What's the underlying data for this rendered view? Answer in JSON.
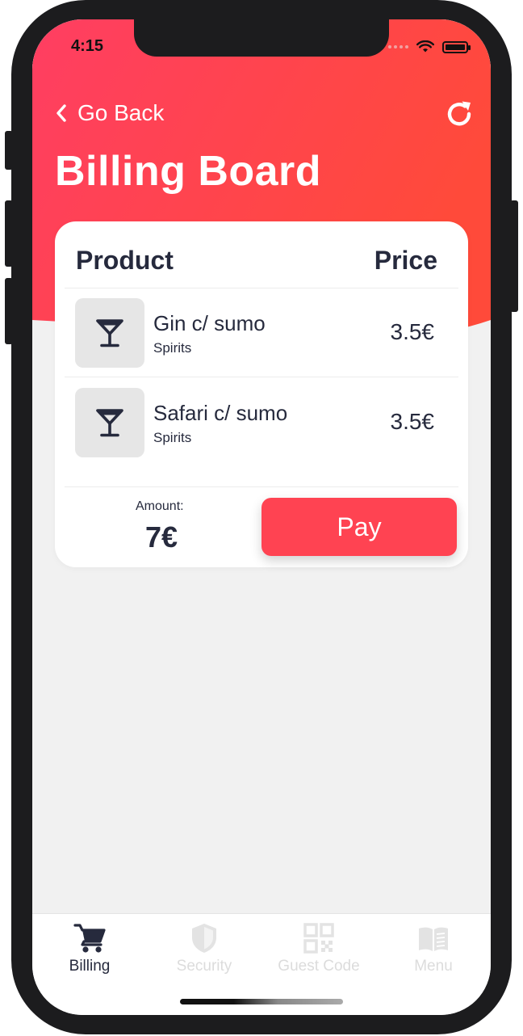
{
  "status_bar": {
    "time": "4:15"
  },
  "header": {
    "back_label": "Go Back",
    "title": "Billing Board",
    "gradient_start": "#ff3e62",
    "gradient_end": "#ff4a3a"
  },
  "table": {
    "headers": {
      "product": "Product",
      "price": "Price"
    },
    "items": [
      {
        "name": "Gin c/ sumo",
        "category": "Spirits",
        "price": "3.5€",
        "icon": "cocktail-glass-icon"
      },
      {
        "name": "Safari c/ sumo",
        "category": "Spirits",
        "price": "3.5€",
        "icon": "cocktail-glass-icon"
      }
    ]
  },
  "summary": {
    "amount_label": "Amount:",
    "amount_value": "7€",
    "pay_label": "Pay",
    "pay_color": "#ff4352"
  },
  "tabbar": {
    "tabs": [
      {
        "label": "Billing",
        "icon": "cart-icon",
        "active": true
      },
      {
        "label": "Security",
        "icon": "shield-icon",
        "active": false
      },
      {
        "label": "Guest Code",
        "icon": "qr-code-icon",
        "active": false
      },
      {
        "label": "Menu",
        "icon": "book-icon",
        "active": false
      }
    ]
  }
}
